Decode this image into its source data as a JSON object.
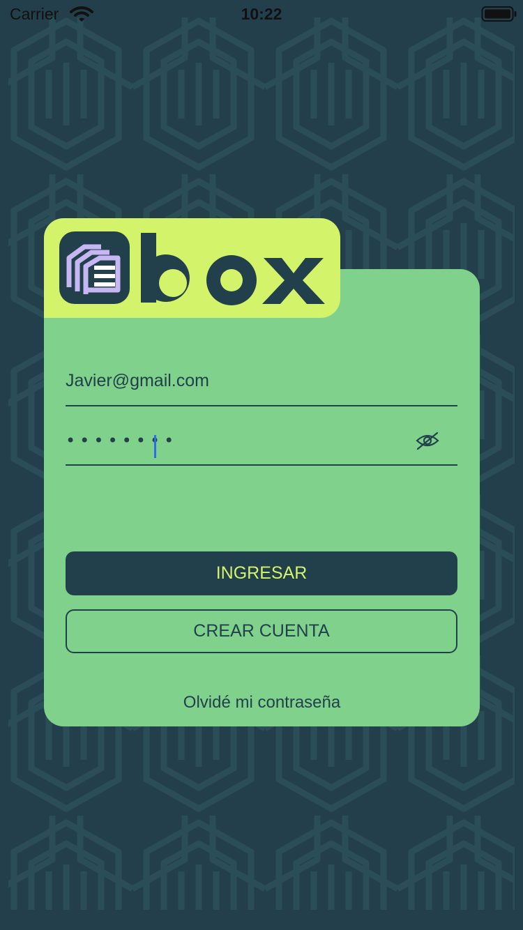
{
  "status_bar": {
    "carrier": "Carrier",
    "time": "10:22"
  },
  "login": {
    "email_value": "Javier@gmail.com",
    "password_value": "••••••••"
  },
  "buttons": {
    "login_label": "INGRESAR",
    "create_account_label": "CREAR CUENTA"
  },
  "links": {
    "forgot_password": "Olvidé mi contraseña"
  },
  "icons": {
    "wifi": "wifi-icon",
    "battery": "battery-icon",
    "visibility": "eye-off-icon",
    "logo_mark": "box-logo-mark"
  },
  "colors": {
    "background": "#243f4c",
    "card": "#80d18b",
    "logo_tab": "#d3f36b",
    "primary": "#22404c",
    "accent": "#c6b6f2"
  }
}
